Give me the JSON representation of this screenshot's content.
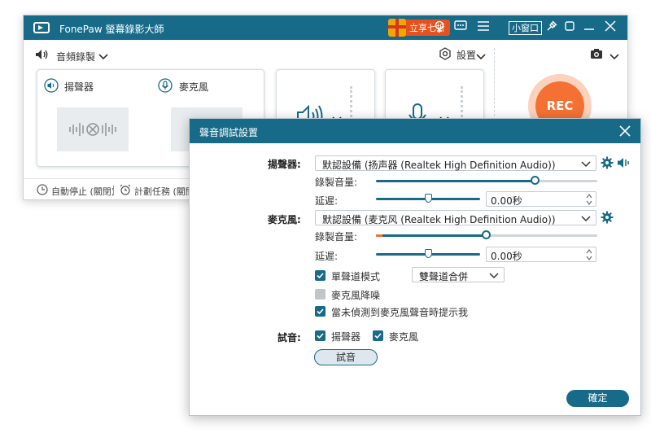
{
  "colors": {
    "accent": "#176b88",
    "rec": "#f47133",
    "promo": "#e8501d"
  },
  "main": {
    "app_title": "FonePaw 螢幕錄影大師",
    "promo_label": "立享七折",
    "mini_window_label": "小窗口",
    "audio_record_label": "音頻錄製",
    "settings_label": "設置",
    "sources": {
      "speaker_label": "揚聲器",
      "mic_label": "麥克風"
    },
    "rec_label": "REC",
    "auto_stop": "自動停止 (關閉)",
    "schedule": "計劃任務 (關閉"
  },
  "dialog": {
    "title": "聲音調試設置",
    "speaker": {
      "label": "揚聲器:",
      "device": "默認設備 (扬声器 (Realtek High Definition Audio))",
      "volume_label": "錄製音量:",
      "volume_level": 0.72,
      "delay_label": "延遲:",
      "delay_value": "0.00秒"
    },
    "mic": {
      "label": "麥克風:",
      "device": "默認設備 (麦克风 (Realtek High Definition Audio))",
      "volume_label": "錄製音量:",
      "volume_level": 0.5,
      "delay_label": "延遲:",
      "delay_value": "0.00秒"
    },
    "mono_mode_label": "單聲道模式",
    "mono_mode_option": "雙聲道合併",
    "noise_label": "麥克風降噪",
    "notify_label": "當未偵測到麥克風聲音時提示我",
    "test_label": "試音:",
    "test_speaker": "揚聲器",
    "test_mic": "麥克風",
    "test_button": "試音",
    "ok_button": "確定"
  }
}
